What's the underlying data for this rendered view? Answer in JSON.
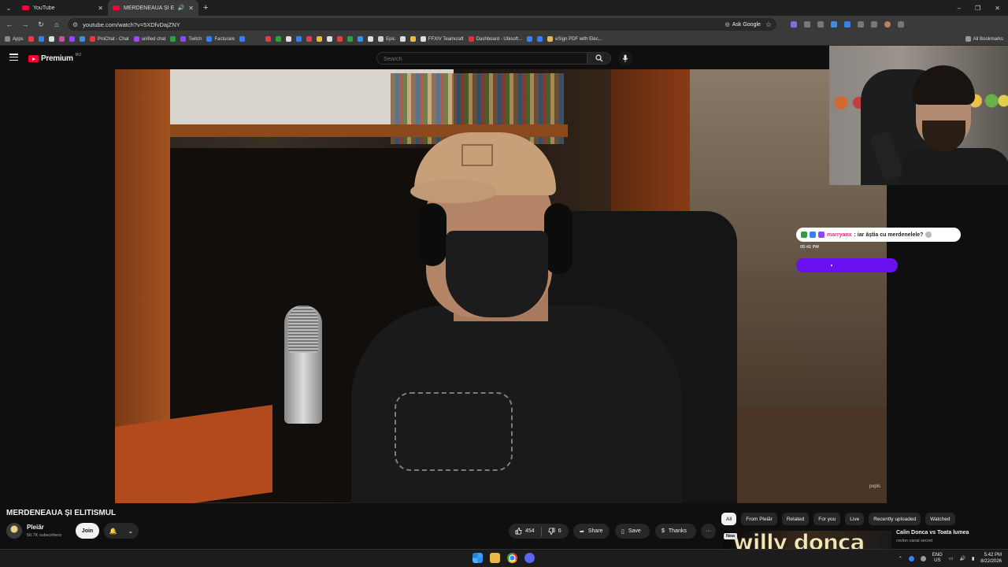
{
  "browser": {
    "tabs": [
      {
        "label": "YouTube",
        "active": false
      },
      {
        "label": "MERDENEAUA ȘI ELITISMUL",
        "active": true
      }
    ],
    "url": "youtube.com/watch?v=5XDfvDajZNY",
    "ask_google": "Ask Google"
  },
  "bookmarks": {
    "apps": "Apps",
    "items": [
      {
        "label": "ProChat - Chat",
        "color": "#e04040"
      },
      {
        "label": "unified chat",
        "color": "#9a4af0"
      },
      {
        "label": "Twitch",
        "color": "#9146ff"
      },
      {
        "label": "Facturare",
        "color": "#3a80f0"
      },
      {
        "label": "Epic",
        "color": "#cccccc"
      },
      {
        "label": "FFXIV Teamcraft",
        "color": "#dddddd"
      },
      {
        "label": "Dashboard - Ubisoft...",
        "color": "#e03030"
      },
      {
        "label": "eSign PDF with Elec...",
        "color": "#e8b84a"
      }
    ],
    "all": "All Bookmarks"
  },
  "youtube": {
    "logo_text": "Premium",
    "region": "RO",
    "search_placeholder": "Search"
  },
  "player": {
    "watermark": "pxpls"
  },
  "chat_overlay": {
    "username": "marryanx",
    "message": ": iar ăștia cu merdenelele?",
    "time": "05:41 PM",
    "badge_colors": [
      "#2ea043",
      "#3a80f0",
      "#9146ff"
    ]
  },
  "video": {
    "title": "MERDENEAUA ȘI ELITISMUL",
    "channel": "Pleiăr",
    "subscribers": "50.7K subscribers",
    "join": "Join",
    "likes": "454",
    "dislikes": "6",
    "share": "Share",
    "save": "Save",
    "thanks": "Thanks"
  },
  "related_chips": [
    "All",
    "From Pleiăr",
    "Related",
    "For you",
    "Live",
    "Recently uploaded",
    "Watched"
  ],
  "recommended": {
    "badge": "New",
    "thumb_text": "willy donca",
    "title": "Calin Donca vs Toata lumea",
    "channel": "rovlon canal secret"
  },
  "taskbar": {
    "lang_top": "ENG",
    "lang_bottom": "US",
    "time": "5:42 PM",
    "date": "8/22/2026"
  },
  "colors": {
    "accent_red": "#ff0033",
    "chat_pill": "#6a0ff0",
    "chat_user": "#e0307a"
  }
}
